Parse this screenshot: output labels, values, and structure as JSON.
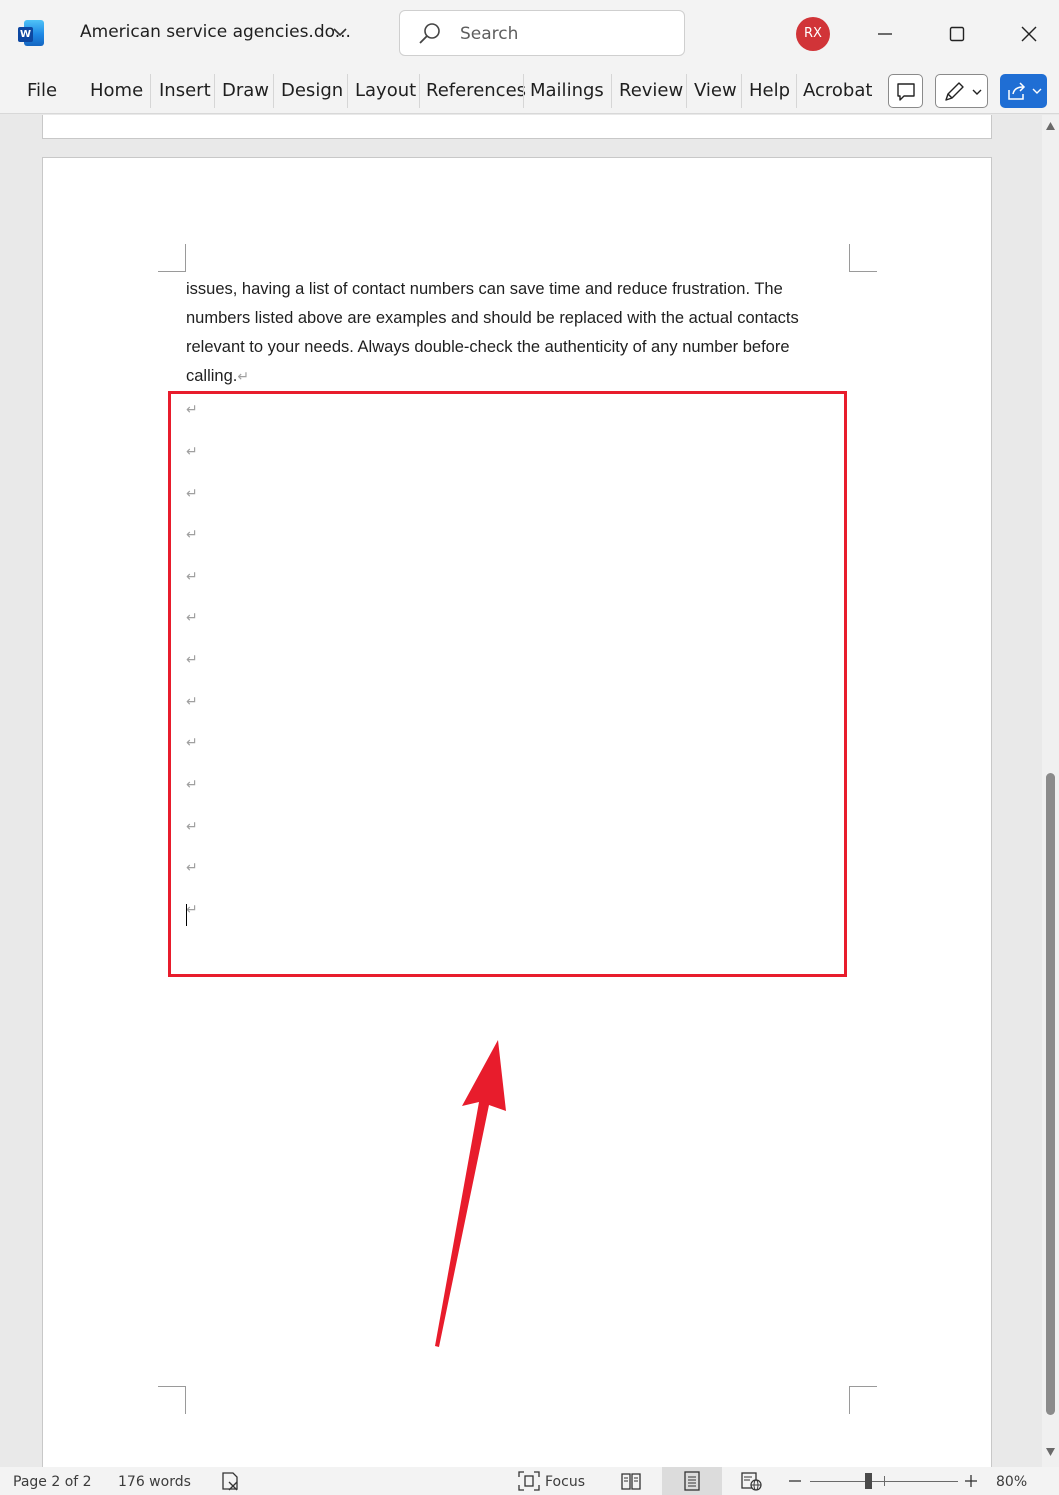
{
  "window": {
    "document_title": "American service agencies.do...",
    "search_placeholder": "Search",
    "user_initials": "RX"
  },
  "ribbon": {
    "tabs": [
      "File",
      "Home",
      "Insert",
      "Draw",
      "Design",
      "Layout",
      "References",
      "Mailings",
      "Review",
      "View",
      "Help",
      "Acrobat"
    ]
  },
  "document": {
    "paragraph_lines": [
      "issues, having a list of contact numbers can save time and reduce frustration. The",
      "numbers listed above are examples and should be replaced with the actual contacts",
      "relevant to your needs. Always double-check the authenticity of any number before",
      "calling."
    ],
    "paragraph_mark": "↵",
    "empty_paragraph_count": 13
  },
  "status": {
    "page": "Page 2 of 2",
    "words": "176 words",
    "focus_label": "Focus",
    "zoom_level": "80%"
  },
  "colors": {
    "annotation_red": "#e81c2c",
    "share_blue": "#1f6ed4",
    "avatar_red": "#d13438"
  }
}
